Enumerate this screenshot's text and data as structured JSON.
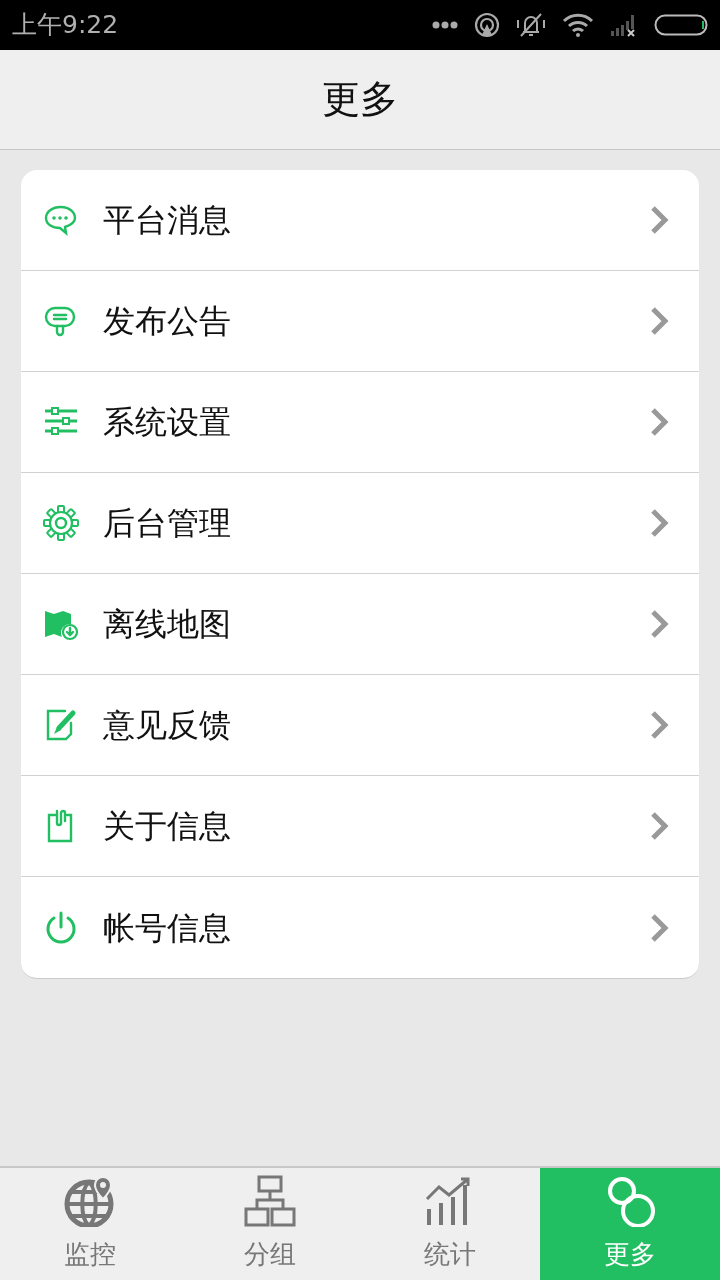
{
  "status_bar": {
    "time": "上午9:22"
  },
  "header": {
    "title": "更多"
  },
  "menu": [
    {
      "label": "平台消息"
    },
    {
      "label": "发布公告"
    },
    {
      "label": "系统设置"
    },
    {
      "label": "后台管理"
    },
    {
      "label": "离线地图"
    },
    {
      "label": "意见反馈"
    },
    {
      "label": "关于信息"
    },
    {
      "label": "帐号信息"
    }
  ],
  "tabs": [
    {
      "label": "监控",
      "selected": false
    },
    {
      "label": "分组",
      "selected": false
    },
    {
      "label": "统计",
      "selected": false
    },
    {
      "label": "更多",
      "selected": true
    }
  ]
}
